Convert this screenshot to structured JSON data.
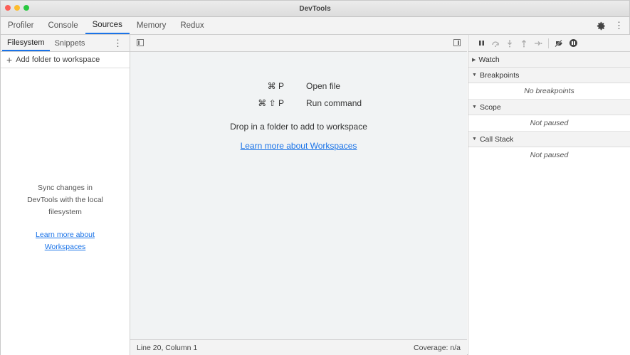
{
  "window": {
    "title": "DevTools"
  },
  "main_tabs": [
    {
      "label": "Profiler",
      "active": false
    },
    {
      "label": "Console",
      "active": false
    },
    {
      "label": "Sources",
      "active": true
    },
    {
      "label": "Memory",
      "active": false
    },
    {
      "label": "Redux",
      "active": false
    }
  ],
  "left_panel": {
    "tabs": [
      {
        "label": "Filesystem",
        "active": true
      },
      {
        "label": "Snippets",
        "active": false
      }
    ],
    "add_folder_label": "Add folder to workspace",
    "sync_text": [
      "Sync changes in",
      "DevTools with the local",
      "filesystem"
    ],
    "learn_more_link": [
      "Learn more about",
      "Workspaces"
    ]
  },
  "center_panel": {
    "shortcuts": [
      {
        "keys": "⌘ P",
        "label": "Open file"
      },
      {
        "keys": "⌘ ⇧ P",
        "label": "Run command"
      }
    ],
    "drop_text": "Drop in a folder to add to workspace",
    "learn_more_link": "Learn more about Workspaces",
    "status_left": "Line 20, Column 1",
    "status_right": "Coverage: n/a"
  },
  "right_panel": {
    "debugger_buttons": [
      "pause-icon",
      "step-over-icon",
      "step-into-icon",
      "step-out-icon",
      "step-icon",
      "deactivate-breakpoints-icon",
      "pause-on-exceptions-icon"
    ],
    "sections": [
      {
        "title": "Watch",
        "expanded": false,
        "body": ""
      },
      {
        "title": "Breakpoints",
        "expanded": true,
        "body": "No breakpoints"
      },
      {
        "title": "Scope",
        "expanded": true,
        "body": "Not paused"
      },
      {
        "title": "Call Stack",
        "expanded": true,
        "body": "Not paused"
      }
    ]
  },
  "colors": {
    "accent": "#1a73e8",
    "panel_bg": "#f1f3f4",
    "toolbar_bg": "#f3f3f3"
  }
}
